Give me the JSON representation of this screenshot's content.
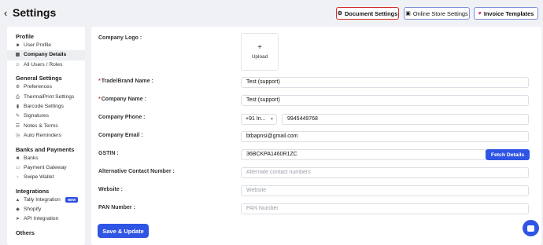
{
  "header": {
    "back_icon": "chevron-left-icon",
    "title": "Settings",
    "buttons": [
      {
        "label": "Document Settings",
        "icon": "gear-icon"
      },
      {
        "label": "Online Store Settings",
        "icon": "store-icon"
      },
      {
        "label": "Invoice Templates",
        "icon": "heart-icon",
        "icon_color": "#e0245e"
      }
    ]
  },
  "sidebar": {
    "sections": [
      {
        "title": "Profile",
        "items": [
          {
            "label": "User Profile",
            "icon": "user-icon"
          },
          {
            "label": "Company Details",
            "icon": "building-icon",
            "active": true
          },
          {
            "label": "All Users / Roles",
            "icon": "users-icon"
          }
        ]
      },
      {
        "title": "General Settings",
        "items": [
          {
            "label": "Preferences",
            "icon": "gear-icon"
          },
          {
            "label": "ThermalPrint Settings",
            "icon": "printer-icon"
          },
          {
            "label": "Barcode Settings",
            "icon": "barcode-icon"
          },
          {
            "label": "Signatures",
            "icon": "signature-icon"
          },
          {
            "label": "Notes & Terms",
            "icon": "note-icon"
          },
          {
            "label": "Auto Reminders",
            "icon": "clock-icon"
          }
        ]
      },
      {
        "title": "Banks and Payments",
        "items": [
          {
            "label": "Banks",
            "icon": "bank-icon"
          },
          {
            "label": "Payment Gateway",
            "icon": "card-icon"
          },
          {
            "label": "Swipe Wallet",
            "icon": "wallet-icon"
          }
        ]
      },
      {
        "title": "Integrations",
        "items": [
          {
            "label": "Tally Integration",
            "icon": "tally-icon",
            "badge": "NEW"
          },
          {
            "label": "Shopify",
            "icon": "shopify-icon"
          },
          {
            "label": "API Integration",
            "icon": "api-icon"
          }
        ]
      },
      {
        "title": "Others",
        "items": []
      }
    ]
  },
  "form": {
    "logo": {
      "label": "Company Logo :",
      "upload_label": "Upload"
    },
    "trade_name": {
      "label": "Trade/Brand Name :",
      "value": "Test (support)",
      "required": true
    },
    "company_name": {
      "label": "Company Name :",
      "value": "Test (support)",
      "required": true
    },
    "phone": {
      "label": "Company Phone :",
      "country_code": "+91 In...",
      "value": "9945449768"
    },
    "email": {
      "label": "Company Email :",
      "value": "btbapnsi@gmail.com"
    },
    "gstin": {
      "label": "GSTIN :",
      "value": "36BCKPA1460R1ZC",
      "fetch_label": "Fetch Details"
    },
    "alt_contact": {
      "label": "Alternative Contact Number :",
      "placeholder": "Alternate contact numbers"
    },
    "website": {
      "label": "Website :",
      "placeholder": "Website"
    },
    "pan": {
      "label": "PAN Number :",
      "placeholder": "PAN Number"
    },
    "save_label": "Save & Update"
  },
  "colors": {
    "accent": "#2f55e4",
    "required": "#d62b2b",
    "highlight_border": "#d62b2b"
  }
}
